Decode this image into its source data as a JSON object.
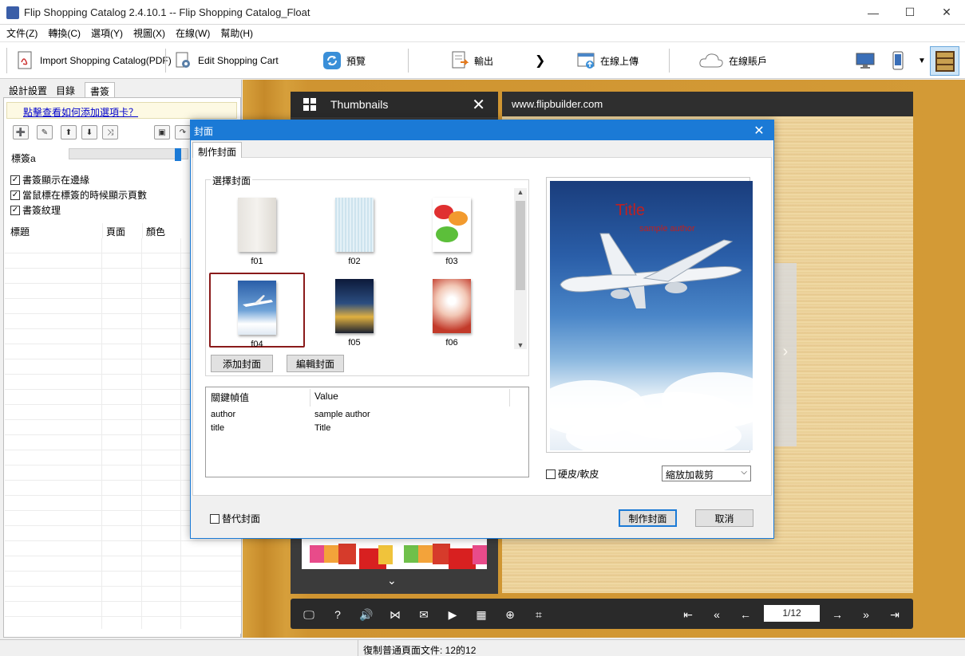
{
  "window": {
    "title": "Flip Shopping Catalog 2.4.10.1 -- Flip Shopping Catalog_Float",
    "minimize": "—",
    "maximize": "☐",
    "close": "✕"
  },
  "menu": [
    "文件(Z)",
    "轉換(C)",
    "選項(Y)",
    "視圖(X)",
    "在線(W)",
    "幫助(H)"
  ],
  "toolbar": {
    "import_label": "Import Shopping Catalog(PDF)",
    "edit_label": "Edit Shopping Cart",
    "preview_label": "預覽",
    "export_label": "輸出",
    "upload_label": "在線上傳",
    "account_label": "在線賬戶"
  },
  "left_panel": {
    "tabs": [
      "設計設置",
      "目錄",
      "書簽"
    ],
    "hint_link": "點擊查看如何添加選項卡？",
    "slider_label": "標簽a",
    "checkboxes": [
      "書簽顯示在邊緣",
      "當鼠標在標簽的時候顯示頁數",
      "書簽紋理"
    ],
    "columns": [
      "標題",
      "頁面",
      "顏色"
    ]
  },
  "viewer": {
    "thumbnails_title": "Thumbnails",
    "url": "www.flipbuilder.com",
    "page_indicator": "1/12"
  },
  "status": {
    "text": "復制普通頁面文件: 12的12"
  },
  "dialog": {
    "title": "封面",
    "close": "✕",
    "tab": "制作封面",
    "group_label": "選擇封面",
    "covers": [
      "f01",
      "f02",
      "f03",
      "f04",
      "f05",
      "f06"
    ],
    "selected_cover": "f04",
    "add_button": "添加封面",
    "edit_button": "編輯封面",
    "kv_headers": [
      "關鍵幀值",
      "Value"
    ],
    "kv_rows": [
      {
        "key": "author",
        "value": "sample author"
      },
      {
        "key": "title",
        "value": "Title"
      }
    ],
    "preview_title": "Title",
    "preview_author": "sample author",
    "hard_cover_label": "硬皮/軟皮",
    "scale_select": "縮放加裁剪",
    "replace_cover_label": "替代封面",
    "make_button": "制作封面",
    "cancel_button": "取消"
  },
  "colors": {
    "accent": "#1b7ad6",
    "selected_border": "#8a1a1a",
    "preview_title": "#c02020"
  }
}
